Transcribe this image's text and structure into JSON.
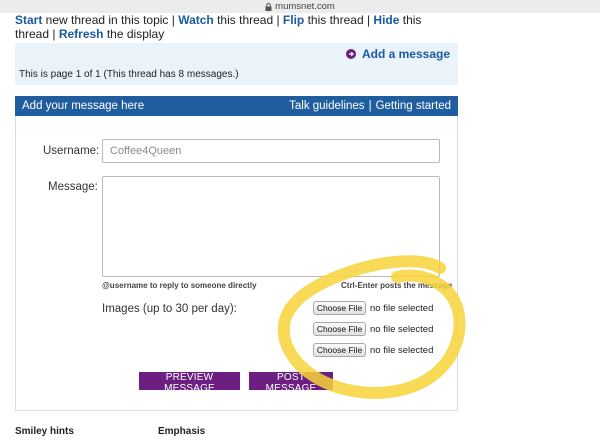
{
  "browser": {
    "url": "mumsnet.com"
  },
  "thread_actions": {
    "start": "Start",
    "start_rest": " new thread in this topic | ",
    "watch": "Watch",
    "watch_rest": " this thread | ",
    "flip": "Flip",
    "flip_rest": " this thread | ",
    "hide": "Hide",
    "hide_rest": " this thread | ",
    "refresh": "Refresh",
    "refresh_rest": " the display"
  },
  "add_message_link": "Add a message",
  "page_info": "This is page 1 of 1 (This thread has 8 messages.)",
  "form_header": {
    "title": "Add your message here",
    "talk_guidelines": "Talk guidelines",
    "separator": "|",
    "getting_started": "Getting started"
  },
  "form": {
    "username_label": "Username:",
    "username_value": "Coffee4Queen",
    "message_label": "Message:",
    "message_value": "",
    "hint_left": "@username to reply to someone directly",
    "hint_right": "Ctrl-Enter posts the message",
    "images_label": "Images (up to 30 per day):",
    "choose_file_label": "Choose File",
    "no_file_text": "no file selected",
    "preview_button": "PREVIEW MESSAGE",
    "post_button": "POST MESSAGE"
  },
  "bottom": {
    "smiley_hints": "Smiley hints",
    "emphasis": "Emphasis"
  },
  "colors": {
    "link_blue": "#1a5aa1",
    "header_blue": "#1f5d9f",
    "button_purple": "#6b2081",
    "light_blue_bg": "#eaf2fa",
    "highlight_yellow": "#f7d338"
  },
  "icons": {
    "url_lock": "lock-icon",
    "add_message": "arrow-circle-icon"
  }
}
